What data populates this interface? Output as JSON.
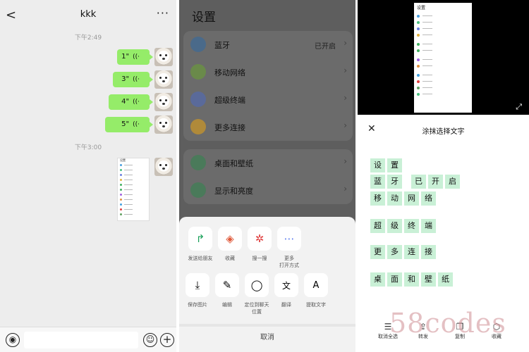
{
  "chat": {
    "title": "kkk",
    "back_icon": "chevron-left-icon",
    "more_label": "···",
    "time1": "下午2:49",
    "time2": "下午3:00",
    "voice_messages": [
      {
        "duration": "1\"",
        "wave": "((·"
      },
      {
        "duration": "3\"",
        "wave": "((·"
      },
      {
        "duration": "4\"",
        "wave": "((·"
      },
      {
        "duration": "5\"",
        "wave": "((·"
      }
    ],
    "voice_btn": "◉",
    "emoji_btn": "☺",
    "plus_btn": "+"
  },
  "settings": {
    "title": "设置",
    "group1": [
      {
        "label": "蓝牙",
        "value": "已开启",
        "color": "#4a6a8a"
      },
      {
        "label": "移动网络",
        "value": "",
        "color": "#6a8a4a"
      },
      {
        "label": "超级终端",
        "value": "",
        "color": "#5a6a9a"
      },
      {
        "label": "更多连接",
        "value": "",
        "color": "#b08a3a"
      }
    ],
    "group2": [
      {
        "label": "桌面和壁纸",
        "value": "",
        "color": "#4a7a5a"
      },
      {
        "label": "显示和亮度",
        "value": "",
        "color": "#4a7a5a"
      }
    ],
    "arrow": "›"
  },
  "share": {
    "row1": [
      {
        "label": "发送给朋友",
        "icon": "↱",
        "icon_name": "forward-icon",
        "color": "#18a058"
      },
      {
        "label": "收藏",
        "icon": "◈",
        "icon_name": "favorite-cube-icon",
        "color": "#e0593a"
      },
      {
        "label": "搜一搜",
        "icon": "✲",
        "icon_name": "search-star-icon",
        "color": "#e04040"
      },
      {
        "label": "更多\n打开方式",
        "icon": "⋯",
        "icon_name": "more-open-icon",
        "color": "#5577ee"
      }
    ],
    "row2": [
      {
        "label": "保存图片",
        "icon": "⤓",
        "icon_name": "save-image-icon",
        "color": "#333"
      },
      {
        "label": "编辑",
        "icon": "✎",
        "icon_name": "edit-icon",
        "color": "#333"
      },
      {
        "label": "定位到聊天\n位置",
        "icon": "◯",
        "icon_name": "chat-bubble-icon",
        "color": "#333"
      },
      {
        "label": "翻译",
        "icon": "文",
        "icon_name": "translate-icon",
        "color": "#333"
      },
      {
        "label": "提取文字",
        "icon": "A",
        "icon_name": "extract-text-icon",
        "color": "#333"
      }
    ],
    "cancel": "取消"
  },
  "smear": {
    "mini_title": "设置",
    "sheet_title": "涂抹选择文字",
    "lines": [
      [
        {
          "t": "设"
        },
        {
          "t": "置"
        }
      ],
      [
        {
          "t": "蓝"
        },
        {
          "t": "牙"
        },
        {
          "t": "已",
          "gap": true
        },
        {
          "t": "开"
        },
        {
          "t": "启"
        }
      ],
      [
        {
          "t": "移"
        },
        {
          "t": "动"
        },
        {
          "t": "网"
        },
        {
          "t": "络"
        }
      ],
      [
        {
          "t": "超"
        },
        {
          "t": "级"
        },
        {
          "t": "终"
        },
        {
          "t": "端"
        }
      ],
      [
        {
          "t": "更"
        },
        {
          "t": "多"
        },
        {
          "t": "连"
        },
        {
          "t": "接"
        }
      ],
      [
        {
          "t": "桌"
        },
        {
          "t": "面"
        },
        {
          "t": "和"
        },
        {
          "t": "壁"
        },
        {
          "t": "纸"
        }
      ]
    ],
    "tools": [
      {
        "label": "取消全选",
        "icon": "☰",
        "icon_name": "deselect-all-icon"
      },
      {
        "label": "转发",
        "icon": "⇪",
        "icon_name": "forward-icon"
      },
      {
        "label": "复制",
        "icon": "❐",
        "icon_name": "copy-icon"
      },
      {
        "label": "收藏",
        "icon": "⬡",
        "icon_name": "favorite-cube-icon"
      }
    ],
    "watermark": "58codes"
  }
}
